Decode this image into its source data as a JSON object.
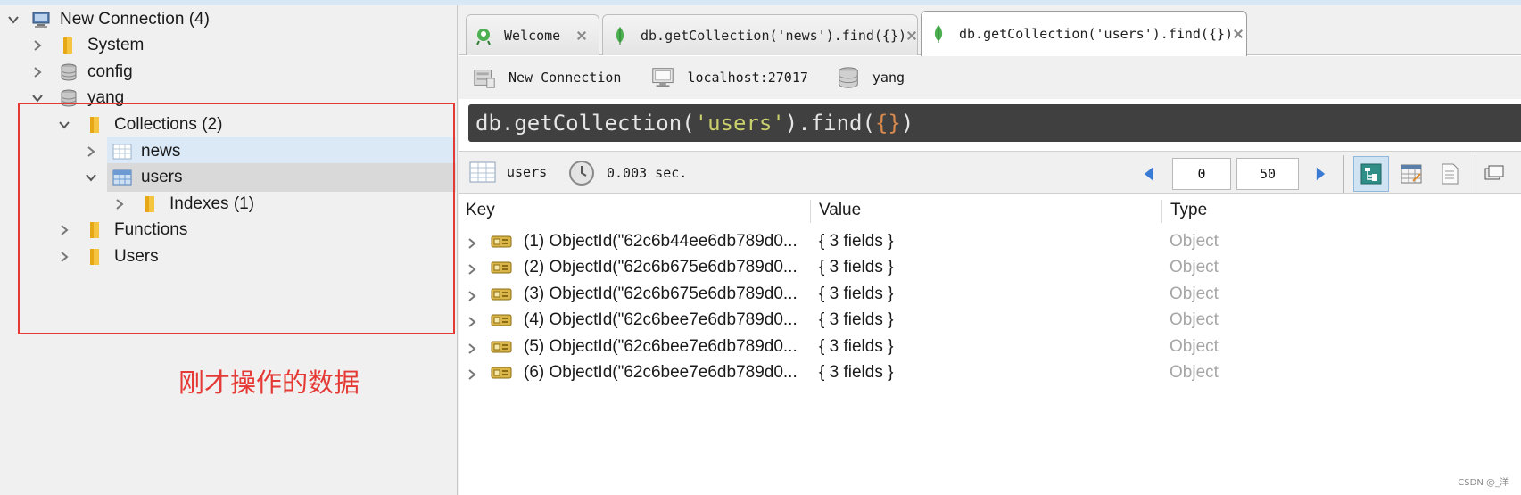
{
  "tree": {
    "connection_label": "New Connection (4)",
    "system_label": "System",
    "config_label": "config",
    "db_label": "yang",
    "collections_label": "Collections (2)",
    "news_label": "news",
    "users_label": "users",
    "indexes_label": "Indexes (1)",
    "functions_label": "Functions",
    "users_folder_label": "Users"
  },
  "annotation": "刚才操作的数据",
  "tabs": [
    {
      "label": "Welcome"
    },
    {
      "label": "db.getCollection('news').find({})"
    },
    {
      "label": "db.getCollection('users').find({})"
    }
  ],
  "connection_bar": {
    "connection": "New Connection",
    "host": "localhost:27017",
    "database": "yang"
  },
  "query": {
    "prefix": "db.getCollection(",
    "string": "'users'",
    "middle": ").find(",
    "braces": "{}",
    "suffix": ")"
  },
  "results": {
    "collection": "users",
    "time": "0.003 sec.",
    "skip": "0",
    "limit": "50"
  },
  "columns": {
    "key": "Key",
    "value": "Value",
    "type": "Type"
  },
  "rows": [
    {
      "key": "(1) ObjectId(\"62c6b44ee6db789d0...",
      "value": "{ 3 fields }",
      "type": "Object"
    },
    {
      "key": "(2) ObjectId(\"62c6b675e6db789d0...",
      "value": "{ 3 fields }",
      "type": "Object"
    },
    {
      "key": "(3) ObjectId(\"62c6b675e6db789d0...",
      "value": "{ 3 fields }",
      "type": "Object"
    },
    {
      "key": "(4) ObjectId(\"62c6bee7e6db789d0...",
      "value": "{ 3 fields }",
      "type": "Object"
    },
    {
      "key": "(5) ObjectId(\"62c6bee7e6db789d0...",
      "value": "{ 3 fields }",
      "type": "Object"
    },
    {
      "key": "(6) ObjectId(\"62c6bee7e6db789d0...",
      "value": "{ 3 fields }",
      "type": "Object"
    }
  ],
  "watermark": "CSDN @_洋",
  "colors": {
    "annotation": "#e53935",
    "selection": "#dbe9f7",
    "query_bg": "#404040"
  }
}
